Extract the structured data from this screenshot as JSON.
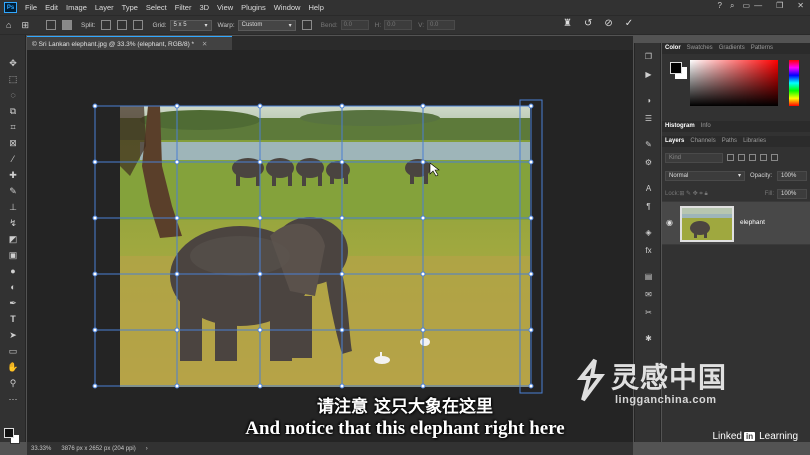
{
  "app": {
    "logo_text": "Ps"
  },
  "menubar": {
    "items": [
      "File",
      "Edit",
      "Image",
      "Layer",
      "Type",
      "Select",
      "Filter",
      "3D",
      "View",
      "Plugins",
      "Window",
      "Help"
    ]
  },
  "options": {
    "split_label": "Split:",
    "grid_label": "Grid:",
    "grid_value": "5 x 5",
    "warp_label": "Warp:",
    "warp_value": "Custom",
    "bend_label": "Bend:",
    "bend_value": "0.0",
    "h_label": "H:",
    "h_value": "0.0",
    "v_label": "V:",
    "v_value": "0.0"
  },
  "document": {
    "tab_title": "© Sri Lankan elephant.jpg @ 33.3% (elephant, RGB/8) *",
    "zoom": "33.33%",
    "info": "3876 px x 2652 px (204 ppi)"
  },
  "panels": {
    "color_tabs": [
      "Color",
      "Swatches",
      "Gradients",
      "Patterns"
    ],
    "hist_tabs": [
      "Histogram",
      "Info"
    ],
    "layer_tabs": [
      "Layers",
      "Channels",
      "Paths",
      "Libraries"
    ],
    "kind_placeholder": "Kind",
    "blend_mode": "Normal",
    "opacity_label": "Opacity:",
    "opacity_value": "100%",
    "lock_label": "Lock:",
    "fill_label": "Fill:",
    "fill_value": "100%",
    "layer_name": "elephant"
  },
  "subtitles": {
    "zh": "请注意 这只大象在这里",
    "en": "And notice that this elephant right here"
  },
  "watermark": {
    "cn": "灵感中国",
    "url": "lingganchina.com"
  },
  "branding": {
    "linkedin_a": "Linked",
    "linkedin_b": "in",
    "linkedin_c": "Learning"
  },
  "colors": {
    "accent": "#31a8ff",
    "panel": "#323232",
    "canvas_bg": "#242424",
    "warp_grid": "#4a7fd4"
  }
}
